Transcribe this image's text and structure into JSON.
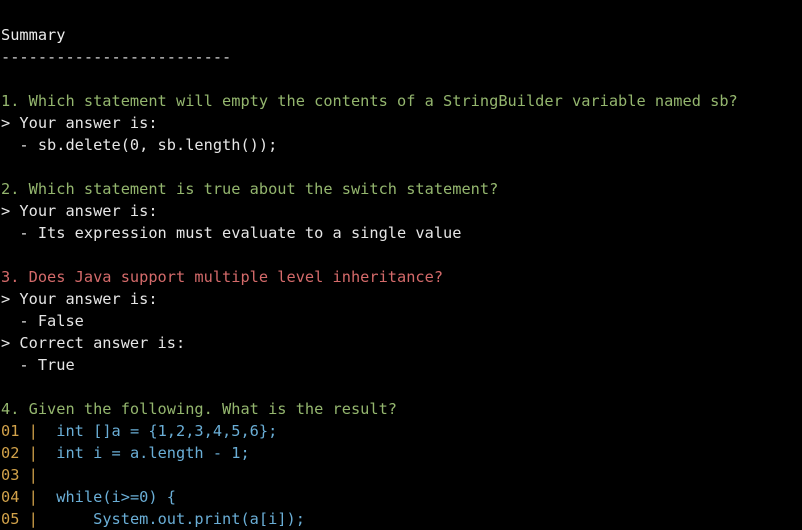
{
  "colors": {
    "background": "#000000",
    "text": "#e6e6e6",
    "question_correct": "#94b66e",
    "question_wrong": "#d46a6a",
    "line_number": "#d2a24a",
    "code": "#6aaed6"
  },
  "summary": {
    "title": "Summary",
    "rule": "-------------------------"
  },
  "q1": {
    "question": "1. Which statement will empty the contents of a StringBuilder variable named sb?",
    "your_label": "> Your answer is:",
    "your_answer": "  - sb.delete(0, sb.length());"
  },
  "q2": {
    "question": "2. Which statement is true about the switch statement?",
    "your_label": "> Your answer is:",
    "your_answer": "  - Its expression must evaluate to a single value"
  },
  "q3": {
    "question": "3. Does Java support multiple level inheritance?",
    "your_label": "> Your answer is:",
    "your_answer": "  - False",
    "correct_label": "> Correct answer is:",
    "correct_answer": "  - True"
  },
  "q4": {
    "question": "4. Given the following. What is the result?",
    "code": [
      {
        "num": "01",
        "text": "int []a = {1,2,3,4,5,6};"
      },
      {
        "num": "02",
        "text": "int i = a.length - 1;"
      },
      {
        "num": "03",
        "text": ""
      },
      {
        "num": "04",
        "text": "while(i>=0) {"
      },
      {
        "num": "05",
        "text": "    System.out.print(a[i]);"
      }
    ]
  }
}
